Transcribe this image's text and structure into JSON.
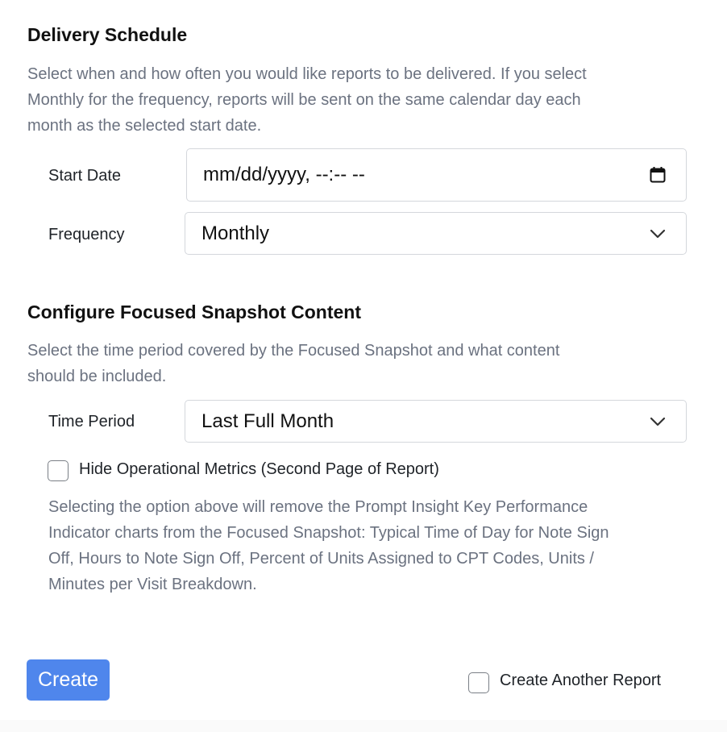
{
  "delivery": {
    "heading": "Delivery Schedule",
    "description": "Select when and how often you would like reports to be delivered. If you select Monthly for the frequency, reports will be sent on the same calendar day each month as the selected start date.",
    "start_date": {
      "label": "Start Date",
      "placeholder": "mm/dd/yyyy, --:-- --",
      "icon": "calendar-icon"
    },
    "frequency": {
      "label": "Frequency",
      "value": "Monthly",
      "icon": "chevron-down-icon"
    }
  },
  "snapshot": {
    "heading": "Configure Focused Snapshot Content",
    "description": "Select the time period covered by the Focused Snapshot and what content should be included.",
    "time_period": {
      "label": "Time Period",
      "value": "Last Full Month",
      "icon": "chevron-down-icon"
    },
    "hide_metrics": {
      "label": "Hide Operational Metrics (Second Page of Report)",
      "checked": false
    },
    "hide_metrics_help": "Selecting the option above will remove the Prompt Insight Key Performance Indicator charts from the Focused Snapshot: Typical Time of Day for Note Sign Off, Hours to Note Sign Off, Percent of Units Assigned to CPT Codes, Units / Minutes per Visit Breakdown."
  },
  "actions": {
    "create_label": "Create",
    "create_another": {
      "label": "Create Another Report",
      "checked": false
    }
  },
  "colors": {
    "primary": "#4f86ec",
    "muted_text": "#6b7280",
    "border": "#d4d7dc"
  }
}
